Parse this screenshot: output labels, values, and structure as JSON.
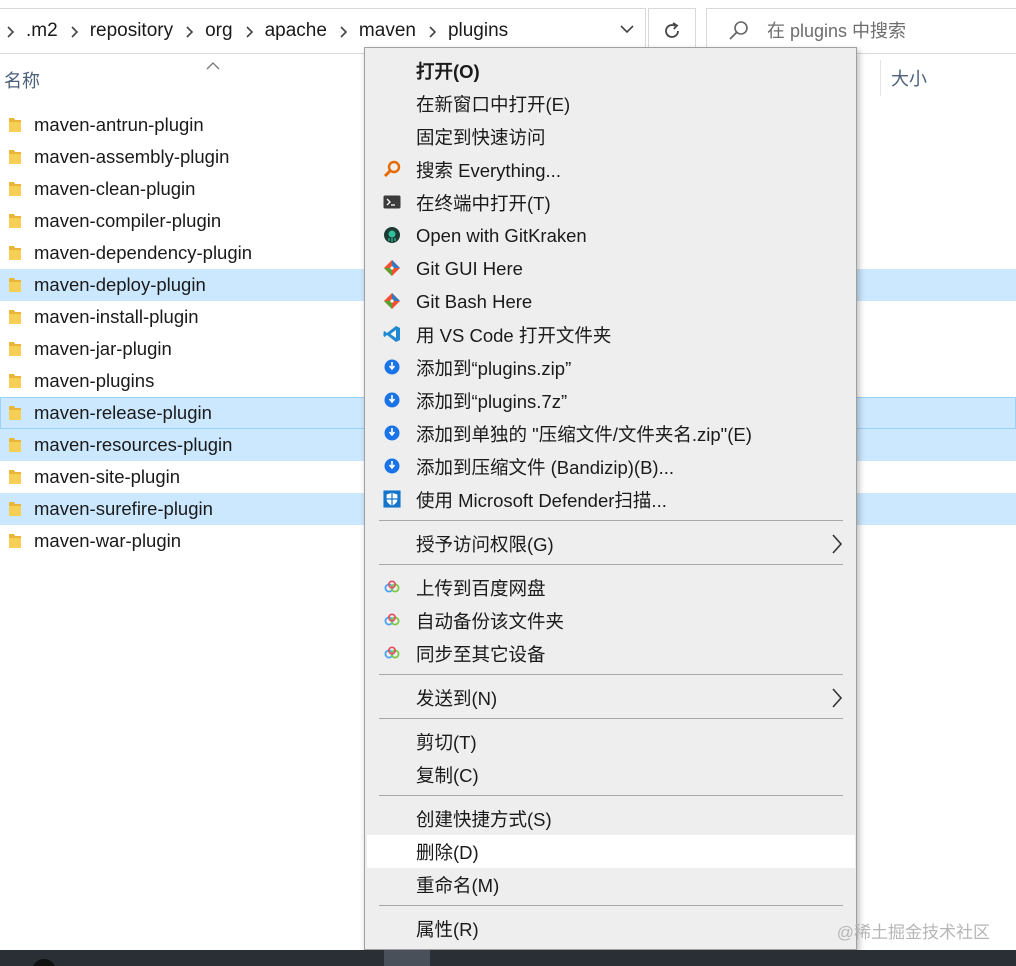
{
  "breadcrumbs": [
    ".m2",
    "repository",
    "org",
    "apache",
    "maven",
    "plugins"
  ],
  "search": {
    "placeholder": "在 plugins 中搜索"
  },
  "columns": {
    "name": "名称",
    "size": "大小"
  },
  "files": [
    {
      "name": "maven-antrun-plugin",
      "selected": false
    },
    {
      "name": "maven-assembly-plugin",
      "selected": false
    },
    {
      "name": "maven-clean-plugin",
      "selected": false
    },
    {
      "name": "maven-compiler-plugin",
      "selected": false
    },
    {
      "name": "maven-dependency-plugin",
      "selected": false
    },
    {
      "name": "maven-deploy-plugin",
      "selected": true
    },
    {
      "name": "maven-install-plugin",
      "selected": false
    },
    {
      "name": "maven-jar-plugin",
      "selected": false
    },
    {
      "name": "maven-plugins",
      "selected": false
    },
    {
      "name": "maven-release-plugin",
      "selected": true
    },
    {
      "name": "maven-resources-plugin",
      "selected": true
    },
    {
      "name": "maven-site-plugin",
      "selected": false
    },
    {
      "name": "maven-surefire-plugin",
      "selected": true
    },
    {
      "name": "maven-war-plugin",
      "selected": false
    }
  ],
  "context_menu": {
    "open": "打开(O)",
    "open_new_window": "在新窗口中打开(E)",
    "pin_quick_access": "固定到快速访问",
    "search_everything": "搜索 Everything...",
    "open_in_terminal": "在终端中打开(T)",
    "open_gitkraken": "Open with GitKraken",
    "git_gui": "Git GUI Here",
    "git_bash": "Git Bash Here",
    "open_vscode": "用 VS Code 打开文件夹",
    "add_zip": "添加到“plugins.zip”",
    "add_7z": "添加到“plugins.7z”",
    "add_separate": "添加到单独的 \"压缩文件/文件夹名.zip\"(E)",
    "add_bandizip": "添加到压缩文件 (Bandizip)(B)...",
    "defender_scan": "使用 Microsoft Defender扫描...",
    "grant_access": "授予访问权限(G)",
    "upload_baidu": "上传到百度网盘",
    "auto_backup": "自动备份该文件夹",
    "sync_devices": "同步至其它设备",
    "send_to": "发送到(N)",
    "cut": "剪切(T)",
    "copy": "复制(C)",
    "create_shortcut": "创建快捷方式(S)",
    "delete": "删除(D)",
    "rename": "重命名(M)",
    "properties": "属性(R)"
  },
  "watermark": "@稀土掘金技术社区",
  "icons": {
    "search_everything": "magnifier-orange-icon",
    "terminal": "terminal-icon",
    "gitkraken": "gitkraken-icon",
    "git": "git-diamond-icon",
    "vscode": "vscode-icon",
    "bandizip": "bandizip-icon",
    "defender": "defender-shield-icon",
    "baidu": "baidu-netdisk-icon"
  },
  "colors": {
    "selection": "#cce8ff",
    "menu_bg": "#eeeeee",
    "hover": "#ffffff",
    "header_text": "#4c607a"
  }
}
